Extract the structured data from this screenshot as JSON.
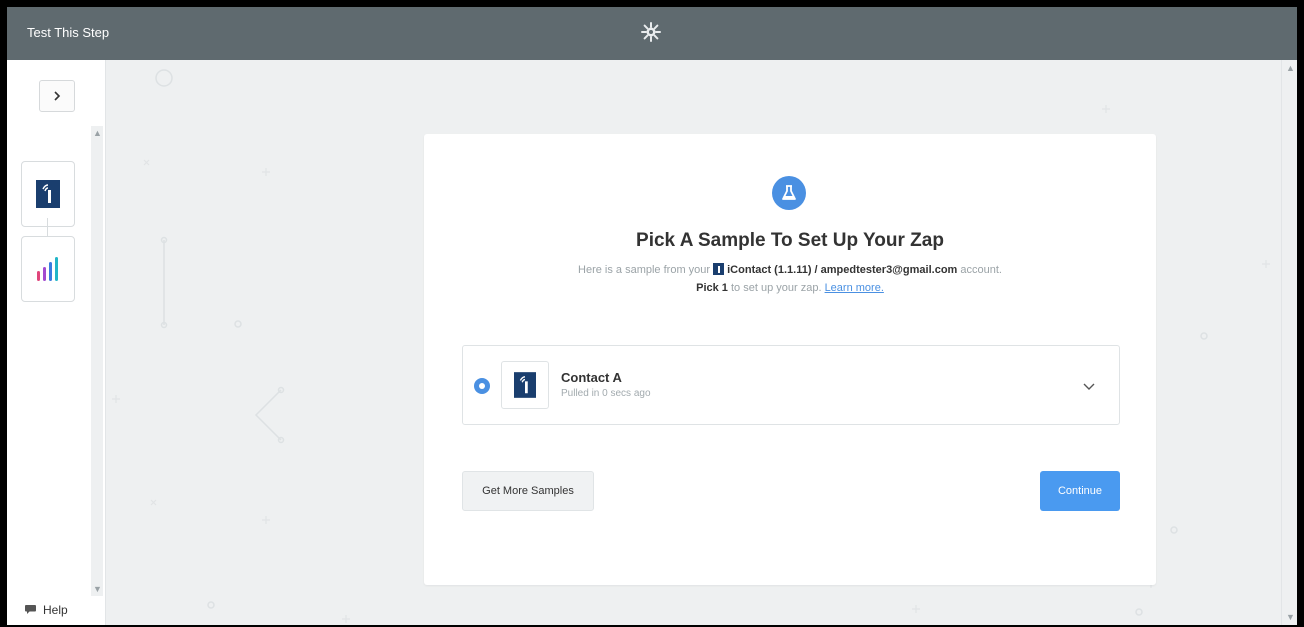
{
  "header": {
    "title": "Test This Step",
    "center_icon": "gear-icon"
  },
  "sidebar": {
    "expand_icon": "chevron-right-icon",
    "steps": [
      {
        "app": "iContact",
        "icon": "icontact-logo-icon"
      },
      {
        "app": "Bars app",
        "icon": "bar-chart-logo-icon"
      }
    ],
    "help_label": "Help"
  },
  "card": {
    "icon": "flask-icon",
    "title": "Pick A Sample To Set Up Your Zap",
    "subtitle_prefix": "Here is a sample from your",
    "account_name": "iContact (1.1.11) / ampedtester3@gmail.com",
    "subtitle_suffix": "account.",
    "pick_bold": "Pick 1",
    "pick_rest": "to set up your zap.",
    "learn_more": "Learn more.",
    "sample": {
      "name": "Contact A",
      "meta": "Pulled in 0 secs ago",
      "selected": true
    },
    "get_more_label": "Get More Samples",
    "continue_label": "Continue"
  },
  "colors": {
    "topbar": "#5f6a6f",
    "accent": "#4a90e2",
    "page_bg": "#eef0f1"
  }
}
